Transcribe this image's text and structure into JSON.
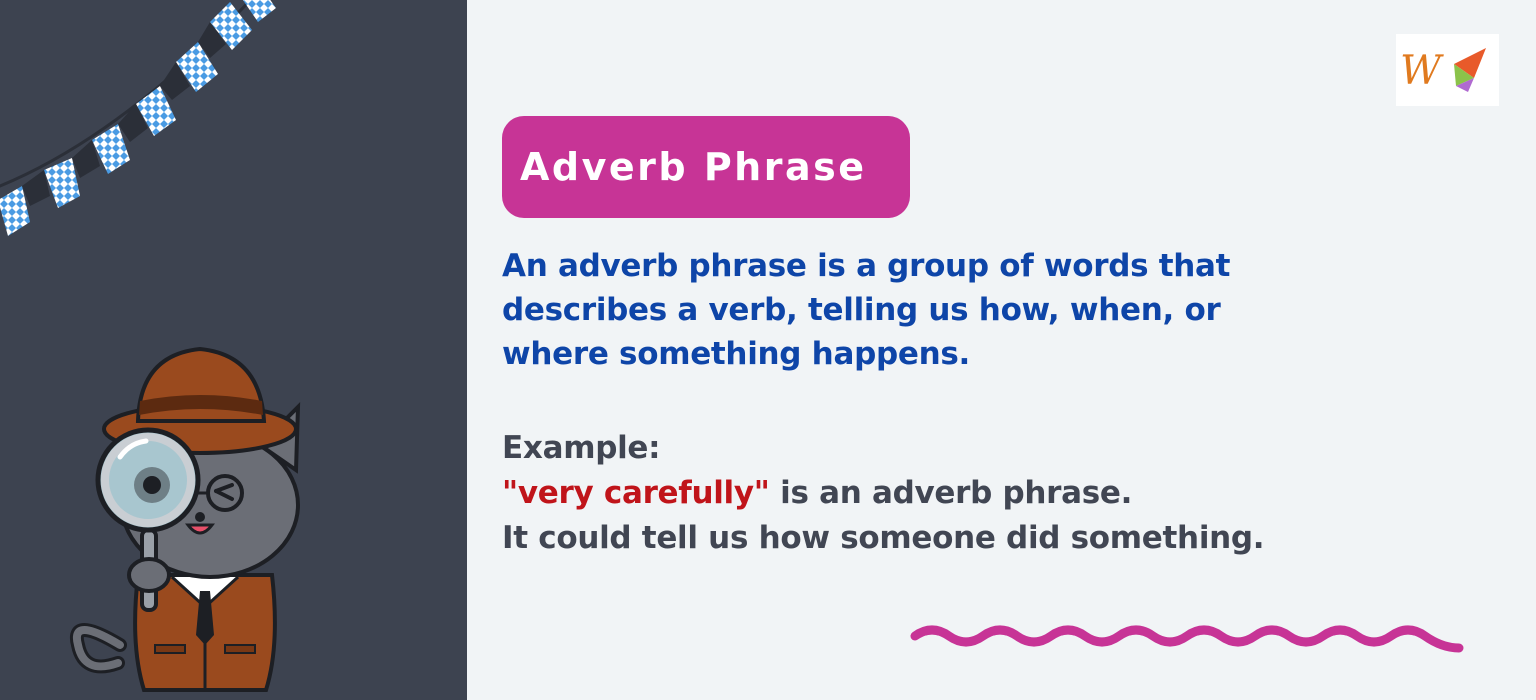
{
  "title": "Adverb Phrase",
  "definition": {
    "line1": "An adverb phrase is a group of words that",
    "line2": "describes a verb, telling us how, when, or",
    "line3": "where something happens."
  },
  "example": {
    "heading": "Example:",
    "highlight": "\"very carefully\"",
    "line1_rest": " is an adverb phrase.",
    "line2": "It could tell us how someone did something."
  },
  "logo": {
    "letter": "W"
  },
  "colors": {
    "left_panel": "#3d4350",
    "background": "#f1f4f6",
    "title_pill": "#c73496",
    "definition_text": "#0e45a8",
    "example_text": "#414653",
    "highlight_text": "#c0141a",
    "squiggle": "#c73496",
    "bunting_blue": "#4a9be3"
  },
  "icons": [
    "bunting-decoration",
    "detective-cat-illustration",
    "magnifying-glass-icon",
    "logo-icon",
    "squiggle-decoration"
  ]
}
